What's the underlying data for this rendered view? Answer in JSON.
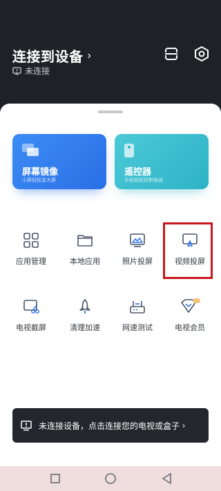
{
  "header": {
    "title": "连接到设备",
    "title_chevron": "›",
    "status_icon": "tv-disconnected-icon",
    "status_text": "未连接",
    "scan_icon": "scan-icon",
    "settings_icon": "hexagon-settings-icon"
  },
  "cards": [
    {
      "title": "屏幕镜像",
      "subtitle": "小屏轻松变大屏",
      "icon": "screen-mirror-icon",
      "color": "#3d8cf5"
    },
    {
      "title": "遥控器",
      "subtitle": "手机轻松控制电视",
      "icon": "remote-control-icon",
      "color": "#35bccc"
    }
  ],
  "grid": [
    {
      "label": "应用管理",
      "icon": "app-grid-icon"
    },
    {
      "label": "本地应用",
      "icon": "folder-icon"
    },
    {
      "label": "照片投屏",
      "icon": "photo-cast-icon"
    },
    {
      "label": "视频投屏",
      "icon": "video-cast-icon"
    },
    {
      "label": "电视截屏",
      "icon": "tv-screenshot-icon"
    },
    {
      "label": "清理加速",
      "icon": "rocket-icon"
    },
    {
      "label": "网速测试",
      "icon": "speed-test-icon"
    },
    {
      "label": "电视会员",
      "icon": "vip-diamond-icon"
    }
  ],
  "banner": {
    "icon": "tv-alert-icon",
    "text": "未连接设备，点击连接您的电视或盒子",
    "chevron": "›"
  },
  "navbar": {
    "recent_icon": "square-icon",
    "home_icon": "circle-icon",
    "back_icon": "triangle-back-icon"
  },
  "colors": {
    "header_bg": "#1f2127",
    "highlight": "#c8151b",
    "banner_bg": "#23262c"
  }
}
